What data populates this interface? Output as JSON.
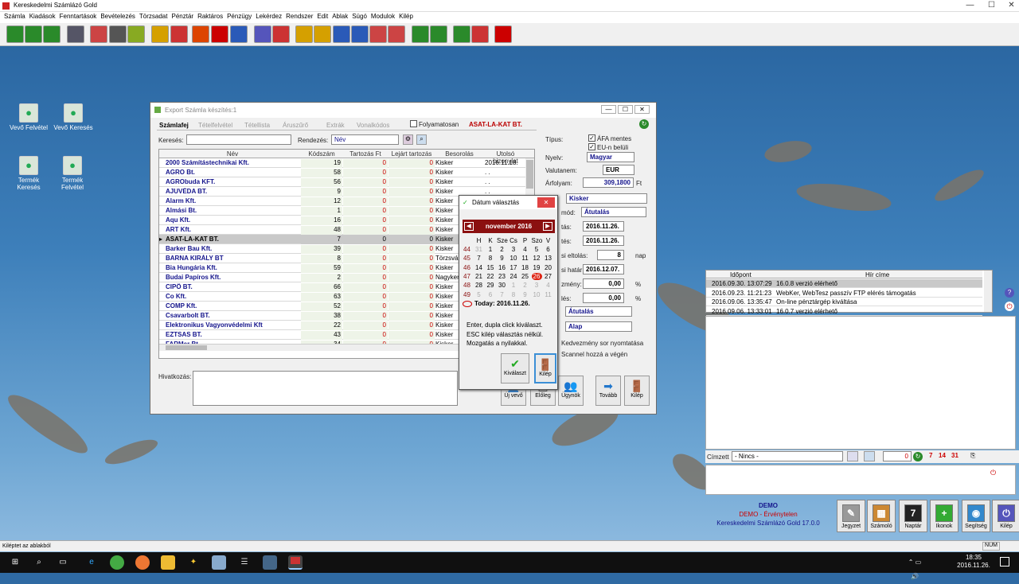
{
  "app": {
    "title": "Kereskedelmi Számlázó Gold"
  },
  "menu": [
    "Számla",
    "Kiadások",
    "Fenntartások",
    "Bevételezés",
    "Törzsadat",
    "Pénztár",
    "Raktáros",
    "Pénzügy",
    "Lekérdez",
    "Rendszer",
    "Edit",
    "Ablak",
    "Súgó",
    "Modulok",
    "Kilép"
  ],
  "desktop_icons": [
    {
      "label": "Vevő Felvétel",
      "icon": "user-icon"
    },
    {
      "label": "Vevő Keresés",
      "icon": "search-user-icon"
    },
    {
      "label": "Termék Keresés",
      "icon": "search-product-icon"
    },
    {
      "label": "Termék Felvétel",
      "icon": "product-icon"
    }
  ],
  "window": {
    "title": "Export Számla készítés:1",
    "tabs": [
      "Számlafej",
      "Tételfelvétel",
      "Tétellista",
      "Áruszűrő",
      "Extrák",
      "Vonalkódos"
    ],
    "folyamatosan": "Folyamatosan",
    "customer": "ASAT-LA-KAT  BT.",
    "search_label": "Keresés:",
    "search_value": "",
    "sort_label": "Rendezés:",
    "sort_value": "Név",
    "columns": [
      "Név",
      "Kódszám",
      "Tartozás Ft",
      "Lejárt tartozás",
      "Besorolás",
      "Utolsó bizonylat"
    ],
    "rows": [
      [
        "2000 Számítástechnikai Kft.",
        "19",
        "0",
        "0",
        "Kisker",
        "2016.11.18."
      ],
      [
        "AGRO Bt.",
        "58",
        "0",
        "0",
        "Kisker",
        ". ."
      ],
      [
        "AGRObuda KFT.",
        "56",
        "0",
        "0",
        "Kisker",
        ". ."
      ],
      [
        "AJUVÉDA  BT.",
        "9",
        "0",
        "0",
        "Kisker",
        ". ."
      ],
      [
        "Alarm  Kft.",
        "12",
        "0",
        "0",
        "Kisker",
        ""
      ],
      [
        "Almási Bt.",
        "1",
        "0",
        "0",
        "Kisker",
        ""
      ],
      [
        "Aqu  Kft.",
        "16",
        "0",
        "0",
        "Kisker",
        ""
      ],
      [
        "ART Kft.",
        "48",
        "0",
        "0",
        "Kisker",
        ""
      ],
      [
        "ASAT-LA-KAT  BT.",
        "7",
        "0",
        "0",
        "Kisker",
        ""
      ],
      [
        "Barker Bau Kft.",
        "39",
        "0",
        "0",
        "Kisker",
        ""
      ],
      [
        "BARNA KIRÁLY BT",
        "8",
        "0",
        "0",
        "Törzsvásá",
        ""
      ],
      [
        "Bia Hungária Kft.",
        "59",
        "0",
        "0",
        "Kisker",
        ""
      ],
      [
        "Budai Papíros Kft.",
        "2",
        "0",
        "0",
        "Nagyker",
        ""
      ],
      [
        "CIPŐ BT.",
        "66",
        "0",
        "0",
        "Kisker",
        ""
      ],
      [
        "Co Kft.",
        "63",
        "0",
        "0",
        "Kisker",
        ""
      ],
      [
        "COMP Kft.",
        "52",
        "0",
        "0",
        "Kisker",
        ""
      ],
      [
        "Csavarbolt BT.",
        "38",
        "0",
        "0",
        "Kisker",
        ""
      ],
      [
        "Elektronikus Vagyonvédelmi Kft",
        "22",
        "0",
        "0",
        "Kisker",
        ""
      ],
      [
        "EZTSAS BT.",
        "43",
        "0",
        "0",
        "Kisker",
        ""
      ],
      [
        "FARMer Bt.",
        "34",
        "0",
        "0",
        "Kisker",
        ""
      ]
    ],
    "selected_row": 8,
    "hivatkozas_label": "Hivatkozás:",
    "right": {
      "tipus_label": "Típus:",
      "afa_mentes": "ÁFA mentes",
      "eu_beluli": "EU-n belüli",
      "nyelv_label": "Nyelv:",
      "nyelv_value": "Magyar",
      "valutanem_label": "Valutanem:",
      "valutanem_value": "EUR",
      "arfolyam_label": "Árfolyam:",
      "arfolyam_value": "309,1800",
      "arfolyam_unit": "Ft",
      "besorolas_value": "Kisker",
      "fizmod_label": "mód:",
      "fizmod_value": "Átutalás",
      "kelt_label": "tás:",
      "kelt_value": "2016.11.26.",
      "telj_label": "tés:",
      "telj_value": "2016.11.26.",
      "eltolas_label": "si eltolás:",
      "eltolas_value": "8",
      "eltolas_unit": "nap",
      "hatarido_label": "si határ:",
      "hatarido_value": "2016.12.07.",
      "kedv_label": "zmény:",
      "kedv_value": "0,00",
      "kedv_unit": "%",
      "kedv2_label": "lés:",
      "kedv2_value": "0,00",
      "kedv2_unit": "%",
      "mod2_value": "Átutalás",
      "alap_value": "Alap",
      "kedv_nyomt": "Kedvezmény sor nyomtatása",
      "scannel": "Scannel hozzá a végén"
    },
    "buttons": [
      "Új vevő",
      "Előleg",
      "Ügynök",
      "Tovább",
      "Kilép"
    ]
  },
  "calendar": {
    "title": "Dátum választás",
    "month": "november 2016",
    "weekdays": [
      "H",
      "K",
      "Sze",
      "Cs",
      "P",
      "Szo",
      "V"
    ],
    "weeks": [
      {
        "wk": "44",
        "days": [
          "31",
          "1",
          "2",
          "3",
          "4",
          "5",
          "6"
        ]
      },
      {
        "wk": "45",
        "days": [
          "7",
          "8",
          "9",
          "10",
          "11",
          "12",
          "13"
        ]
      },
      {
        "wk": "46",
        "days": [
          "14",
          "15",
          "16",
          "17",
          "18",
          "19",
          "20"
        ]
      },
      {
        "wk": "47",
        "days": [
          "21",
          "22",
          "23",
          "24",
          "25",
          "26",
          "27"
        ]
      },
      {
        "wk": "48",
        "days": [
          "28",
          "29",
          "30",
          "1",
          "2",
          "3",
          "4"
        ]
      },
      {
        "wk": "49",
        "days": [
          "5",
          "6",
          "7",
          "8",
          "9",
          "10",
          "11"
        ]
      }
    ],
    "today_label": "Today: 2016.11.26.",
    "help1": "Enter, dupla click kiválaszt.",
    "help2": "ESC kilép választás nélkül.",
    "help3": "Mozgatás a nyilakkal.",
    "select_button": "Kiválaszt",
    "exit_button": "Kilép"
  },
  "news": {
    "columns": [
      "Időpont",
      "Hír címe"
    ],
    "rows": [
      [
        "2016.09.30. 13:07:29",
        "16.0.8 verzió elérhető"
      ],
      [
        "2016.09.23. 11:21:23",
        "WebKer, WebTesz passzív FTP elérés támogatás"
      ],
      [
        "2016.09.06. 13:35:47",
        "On-line pénztárgép kiváltása"
      ],
      [
        "2016.09.06. 13:33:01",
        "16.0.7 verzió elérhető"
      ]
    ]
  },
  "cimzett": {
    "label": "Címzett",
    "value": "- Nincs -",
    "count": "0"
  },
  "demo": {
    "line1": "DEMO",
    "line2": "DEMO - Érvénytelen",
    "line3": "Kereskedelmi Számlázó Gold 17.0.0"
  },
  "bottom_buttons": [
    "Jegyzet",
    "Számoló",
    "Naptár",
    "Ikonok",
    "Segítség",
    "Kilép"
  ],
  "statusbar": {
    "text": "Kiléptet az ablakból",
    "num": "NUM"
  },
  "taskbar": {
    "time": "18:35",
    "date": "2016.11.26."
  }
}
